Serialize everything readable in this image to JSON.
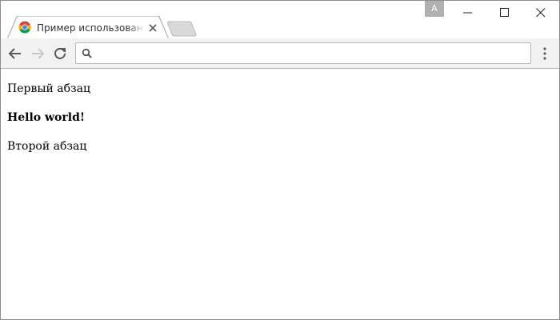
{
  "browser": {
    "tab": {
      "title": "Пример использования",
      "favicon": "chrome-favicon-icon",
      "close_icon": "close-icon"
    },
    "new_tab_icon": "new-tab-icon",
    "profile_badge": "A",
    "window_controls": [
      "minimize-icon",
      "maximize-icon",
      "close-icon"
    ],
    "toolbar": {
      "back_icon": "arrow-left-icon",
      "forward_icon": "arrow-right-icon",
      "forward_enabled": false,
      "reload_icon": "reload-icon",
      "menu_icon": "kebab-menu-icon"
    },
    "omnibox": {
      "icon": "search-icon",
      "value": "",
      "placeholder": ""
    },
    "colors": {
      "toolbar_bg": "#f2f2f2",
      "profile_badge_bg": "#b0b0b0",
      "border": "#8c8c8c"
    }
  },
  "page": {
    "paragraph_1": "Первый абзац",
    "heading": "Hello world!",
    "paragraph_2": "Второй абзац"
  }
}
